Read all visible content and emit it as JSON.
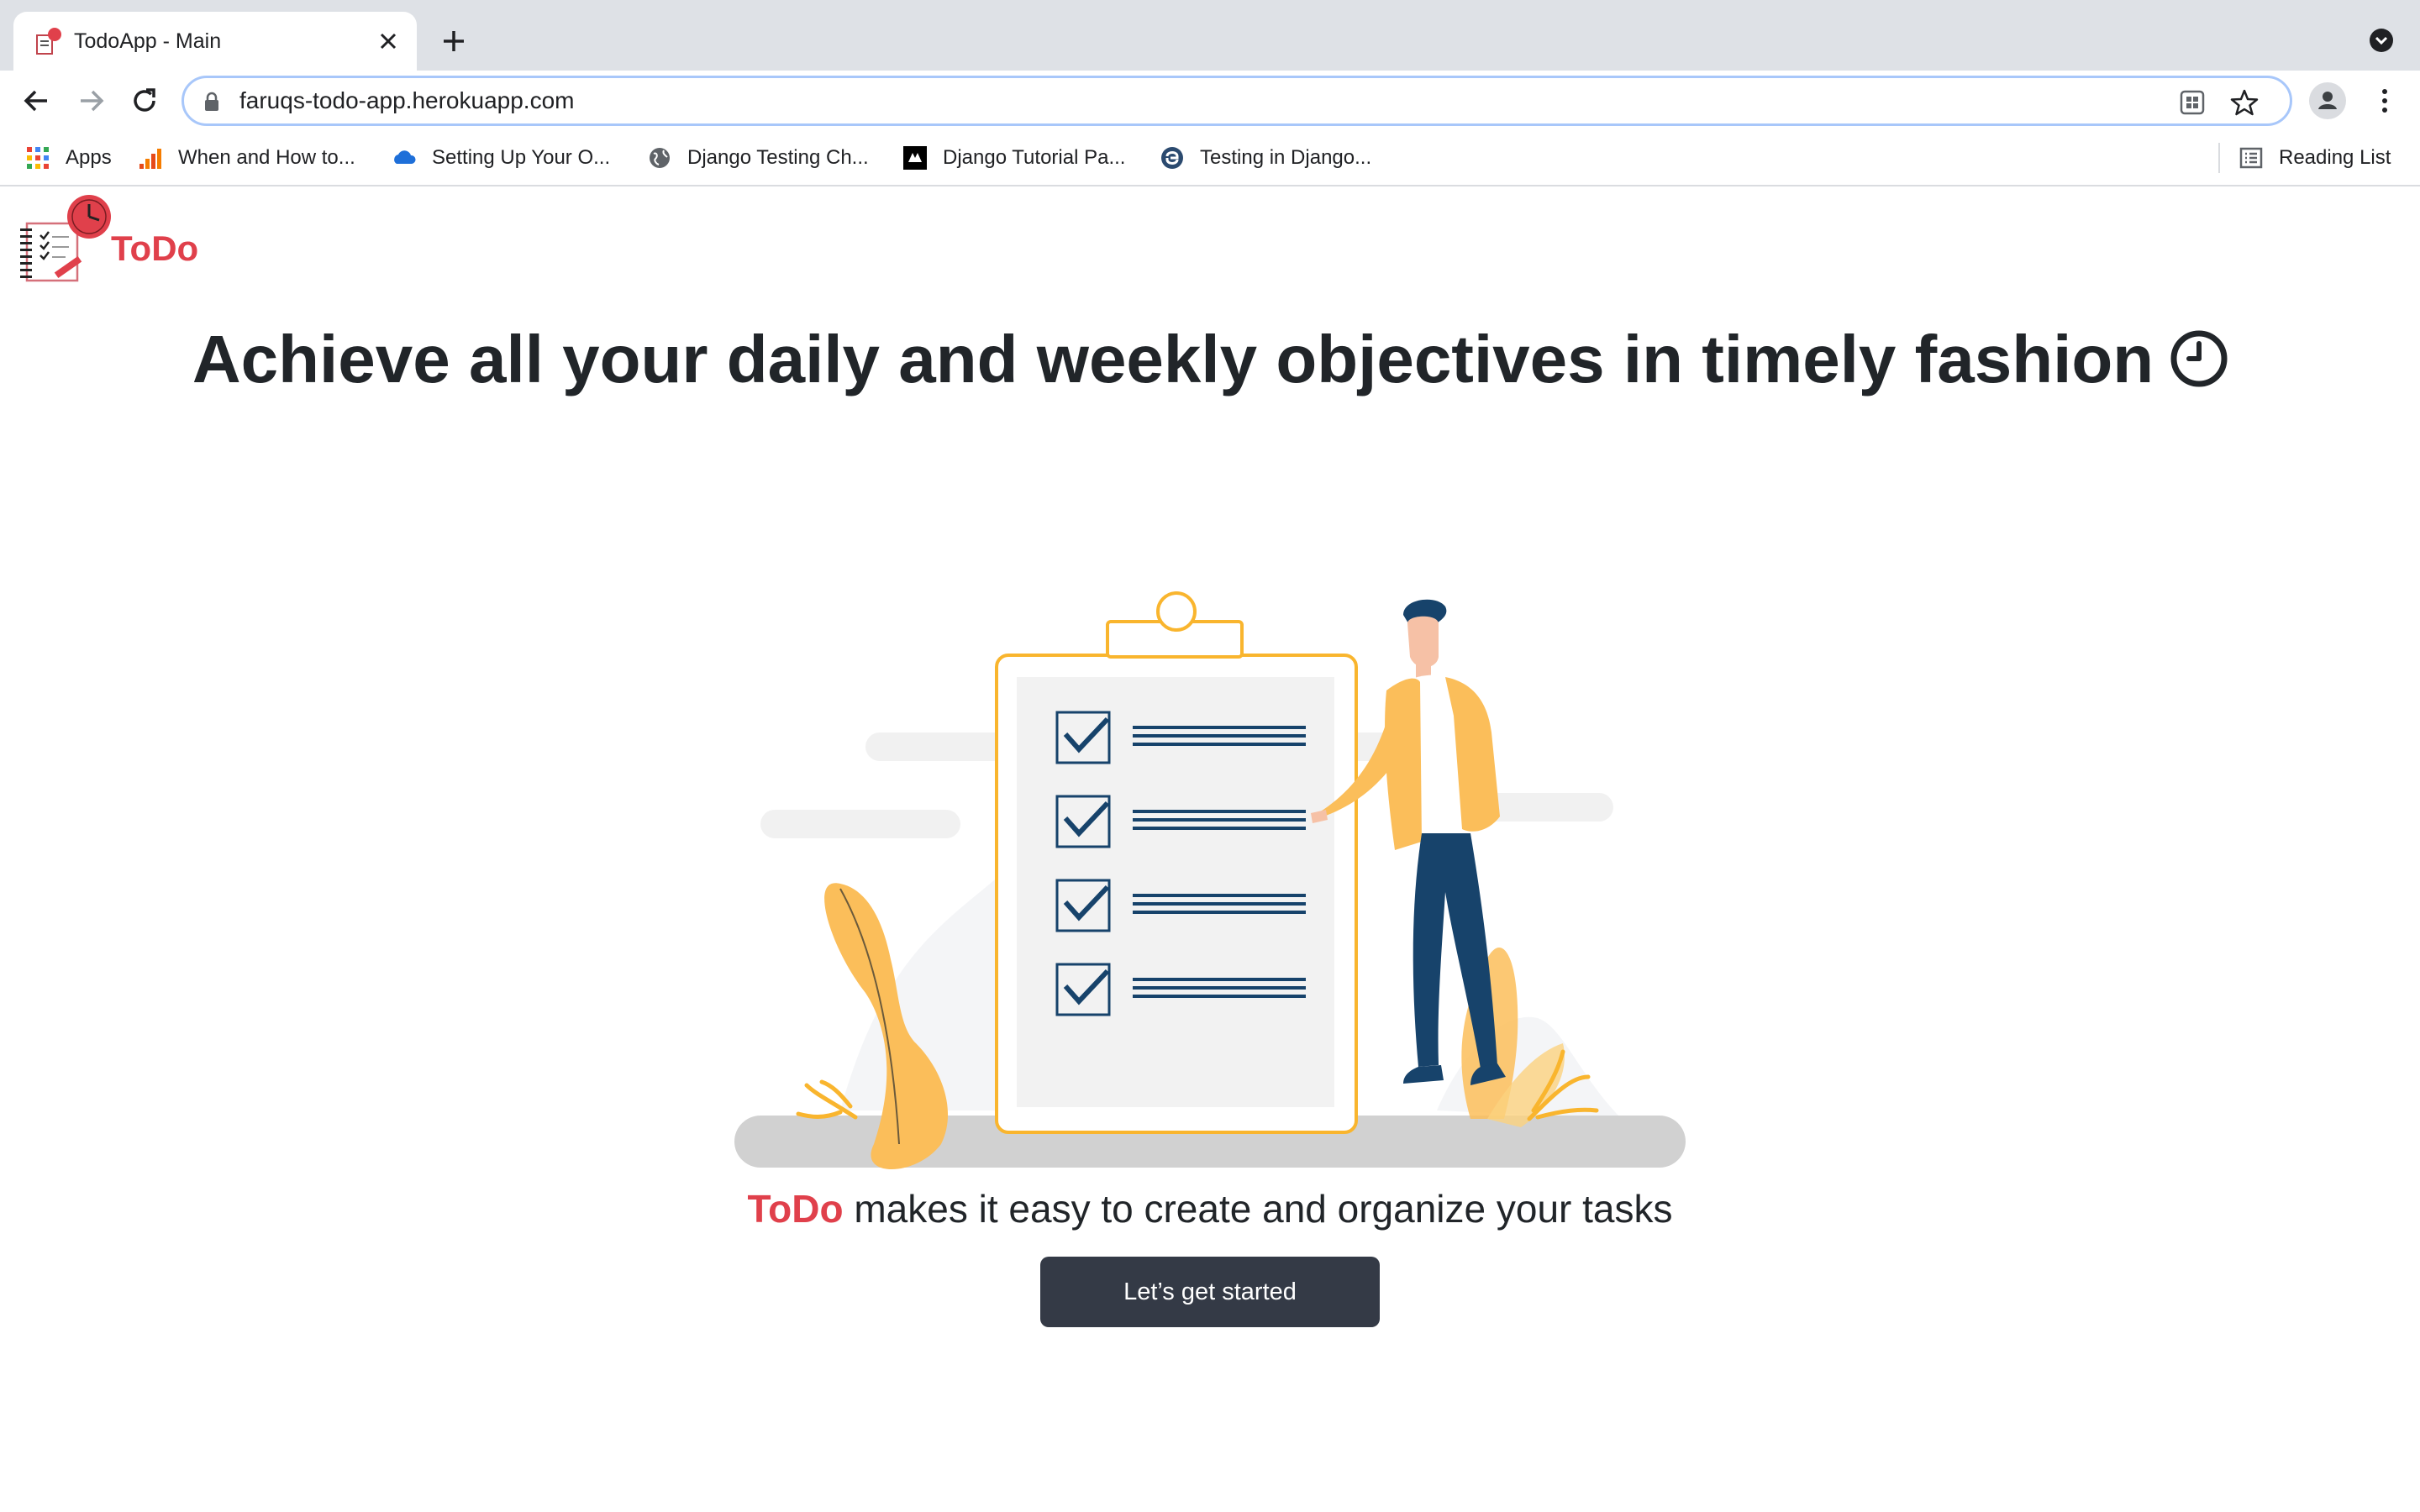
{
  "browser": {
    "tab": {
      "title": "TodoApp - Main"
    },
    "address_bar": {
      "url": "faruqs-todo-app.herokuapp.com"
    },
    "bookmarks": [
      {
        "label": "Apps",
        "icon": "apps-grid-icon"
      },
      {
        "label": "When and How to...",
        "icon": "bars-favicon-icon"
      },
      {
        "label": "Setting Up Your O...",
        "icon": "cloud-favicon-icon"
      },
      {
        "label": "Django Testing Ch...",
        "icon": "globe-icon"
      },
      {
        "label": "Django Tutorial Pa...",
        "icon": "mdn-favicon-icon"
      },
      {
        "label": "Testing in Django...",
        "icon": "python-favicon-icon"
      }
    ],
    "reading_list": "Reading List"
  },
  "navbar": {
    "brand": "ToDo"
  },
  "hero": {
    "headline": "Achieve all your daily and weekly objectives in timely fashion",
    "headline_icon": "clock-icon",
    "tagline_brand": "ToDo",
    "tagline_rest": " makes it easy to create and organize your tasks",
    "cta_label": "Let’s get started"
  },
  "colors": {
    "brand_red": "#e0404b",
    "button_dark": "#343a46",
    "accent_yellow": "#f9b52e",
    "navy": "#17436b",
    "tabstrip": "#dee1e6"
  }
}
